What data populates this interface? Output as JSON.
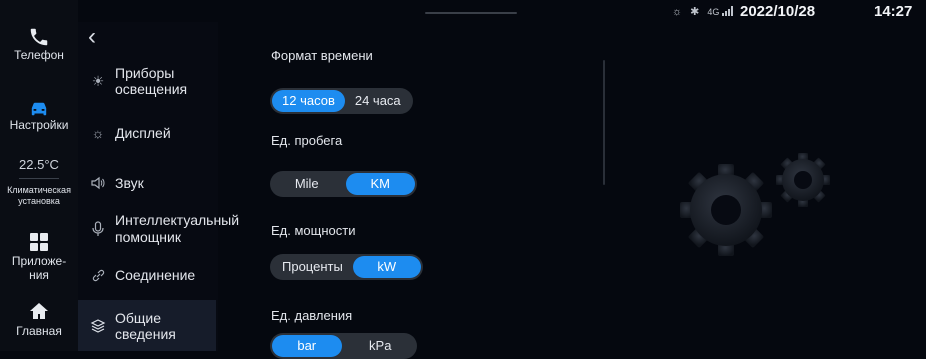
{
  "status": {
    "date": "2022/10/28",
    "time": "14:27",
    "network": "4G"
  },
  "dock": {
    "items": [
      {
        "label": "Телефон",
        "icon": "phone-icon"
      },
      {
        "label": "Настройки",
        "icon": "car-icon"
      },
      {
        "value": "22.5°C",
        "label": "Климатическая установка"
      },
      {
        "label": "Приложе-ния",
        "icon": "apps-grid-icon"
      },
      {
        "label": "Главная",
        "icon": "home-icon"
      }
    ]
  },
  "settings_list": {
    "items": [
      {
        "label": "Приборы освещения",
        "icon": "light-bulb-icon"
      },
      {
        "label": "Дисплей",
        "icon": "sun-icon"
      },
      {
        "label": "Звук",
        "icon": "speaker-icon"
      },
      {
        "label": "Интеллектуальный помощник",
        "icon": "microphone-icon"
      },
      {
        "label": "Соединение",
        "icon": "link-icon"
      },
      {
        "label": "Общие сведения",
        "icon": "layers-icon",
        "active": true
      }
    ]
  },
  "options": {
    "time_format": {
      "label": "Формат времени",
      "opt1": "12 часов",
      "opt2": "24 часа",
      "selected": "12 часов"
    },
    "distance": {
      "label": "Ед. пробега",
      "opt1": "Mile",
      "opt2": "KM",
      "selected": "KM"
    },
    "power": {
      "label": "Ед. мощности",
      "opt1": "Проценты",
      "opt2": "kW",
      "selected": "kW"
    },
    "pressure": {
      "label": "Ед. давления",
      "opt1": "bar",
      "opt2": "kPa",
      "selected": "bar"
    }
  },
  "colors": {
    "accent": "#1d8cf0",
    "background": "#05080f"
  }
}
